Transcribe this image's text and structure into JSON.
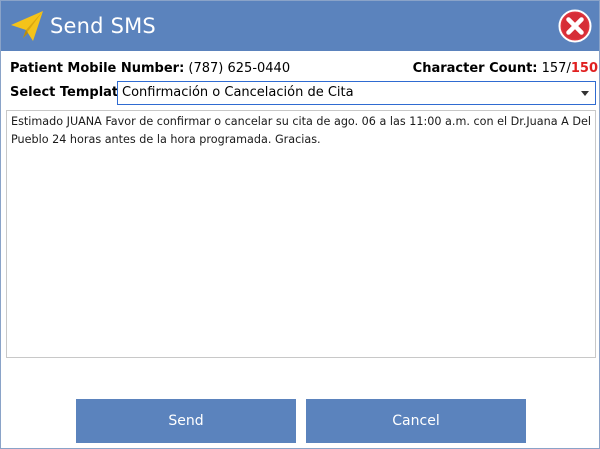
{
  "window": {
    "title": "Send SMS",
    "icons": {
      "title": "paper-plane-icon",
      "close": "close-icon"
    }
  },
  "patient": {
    "mobile_label": "Patient Mobile Number:",
    "mobile_value": "(787) 625-0440"
  },
  "character_count": {
    "label": "Character Count:",
    "current": "157",
    "separator": "/",
    "max": "150",
    "max_color": "#e02020"
  },
  "template": {
    "label": "Select Template:",
    "selected": "Confirmación o Cancelación de Cita"
  },
  "message": {
    "text": "Estimado JUANA Favor de confirmar o cancelar su cita de ago. 06 a las 11:00 a.m. con el Dr.Juana A Del Pueblo 24 horas antes de la hora programada. Gracias."
  },
  "buttons": {
    "send": "Send",
    "cancel": "Cancel"
  },
  "colors": {
    "titlebar": "#5b83bd",
    "button": "#5b83bd",
    "close_icon": "#e0343d",
    "plane_icon": "#f4c31a"
  }
}
